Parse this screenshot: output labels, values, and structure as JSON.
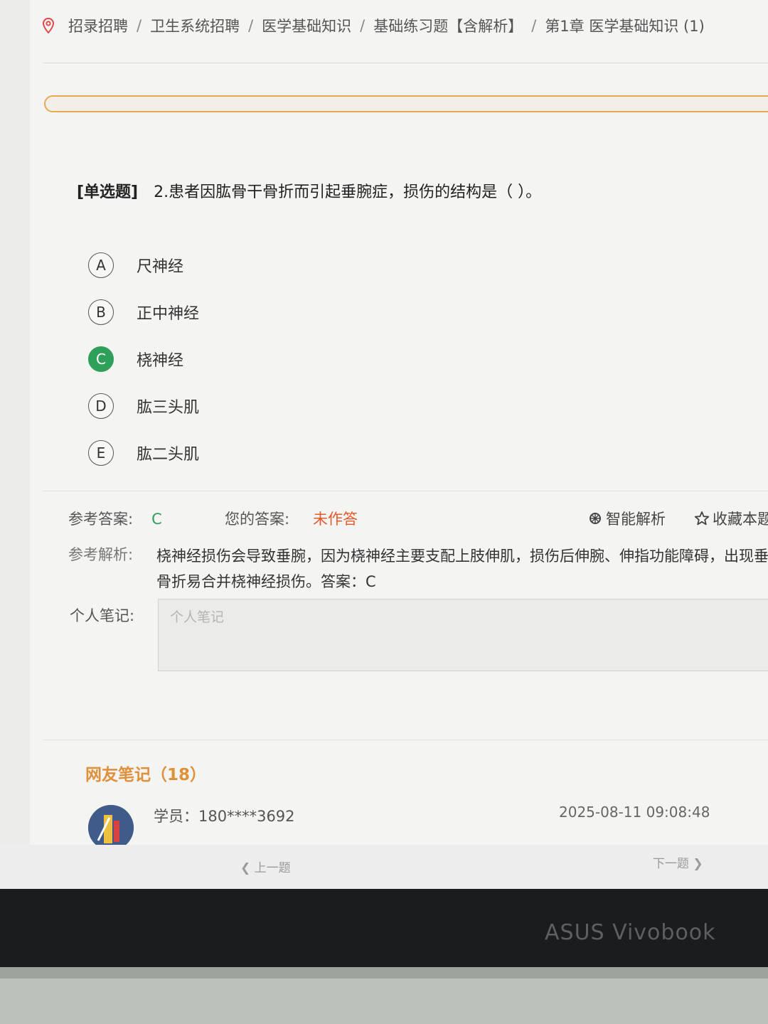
{
  "breadcrumb": {
    "items": [
      "招录招聘",
      "卫生系统招聘",
      "医学基础知识",
      "基础练习题【含解析】",
      "第1章 医学基础知识 (1)"
    ],
    "separator": "/"
  },
  "question": {
    "type": "[单选题]",
    "text": "2.患者因肱骨干骨折而引起垂腕症，损伤的结构是（  ）。"
  },
  "options": [
    {
      "letter": "A",
      "text": "尺神经",
      "correct": false
    },
    {
      "letter": "B",
      "text": "正中神经",
      "correct": false
    },
    {
      "letter": "C",
      "text": "桡神经",
      "correct": true
    },
    {
      "letter": "D",
      "text": "肱三头肌",
      "correct": false
    },
    {
      "letter": "E",
      "text": "肱二头肌",
      "correct": false
    }
  ],
  "answer": {
    "ref_label": "参考答案:",
    "ref_value": "C",
    "your_label": "您的答案:",
    "your_value": "未作答",
    "ai_label": "智能解析",
    "fav_label": "收藏本题"
  },
  "analysis": {
    "label": "参考解析:",
    "line1": "桡神经损伤会导致垂腕，因为桡神经主要支配上肢伸肌，损伤后伸腕、伸指功能障碍，出现垂腕。肱骨干",
    "line2": "骨折易合并桡神经损伤。答案：C"
  },
  "notes": {
    "label": "个人笔记:",
    "placeholder": "个人笔记"
  },
  "netizen": {
    "title": "网友笔记（18）",
    "items": [
      {
        "user": "学员：180****3692",
        "time": "2025-08-11 09:08:48"
      }
    ]
  },
  "pager": {
    "prev": "上一题",
    "next": "下一题"
  },
  "device": {
    "brand": "ASUS Vivobook"
  },
  "colors": {
    "correct": "#2fa05a",
    "unanswered": "#e05a2b",
    "accent": "#e0903a",
    "progress_border": "#e6a94f"
  }
}
